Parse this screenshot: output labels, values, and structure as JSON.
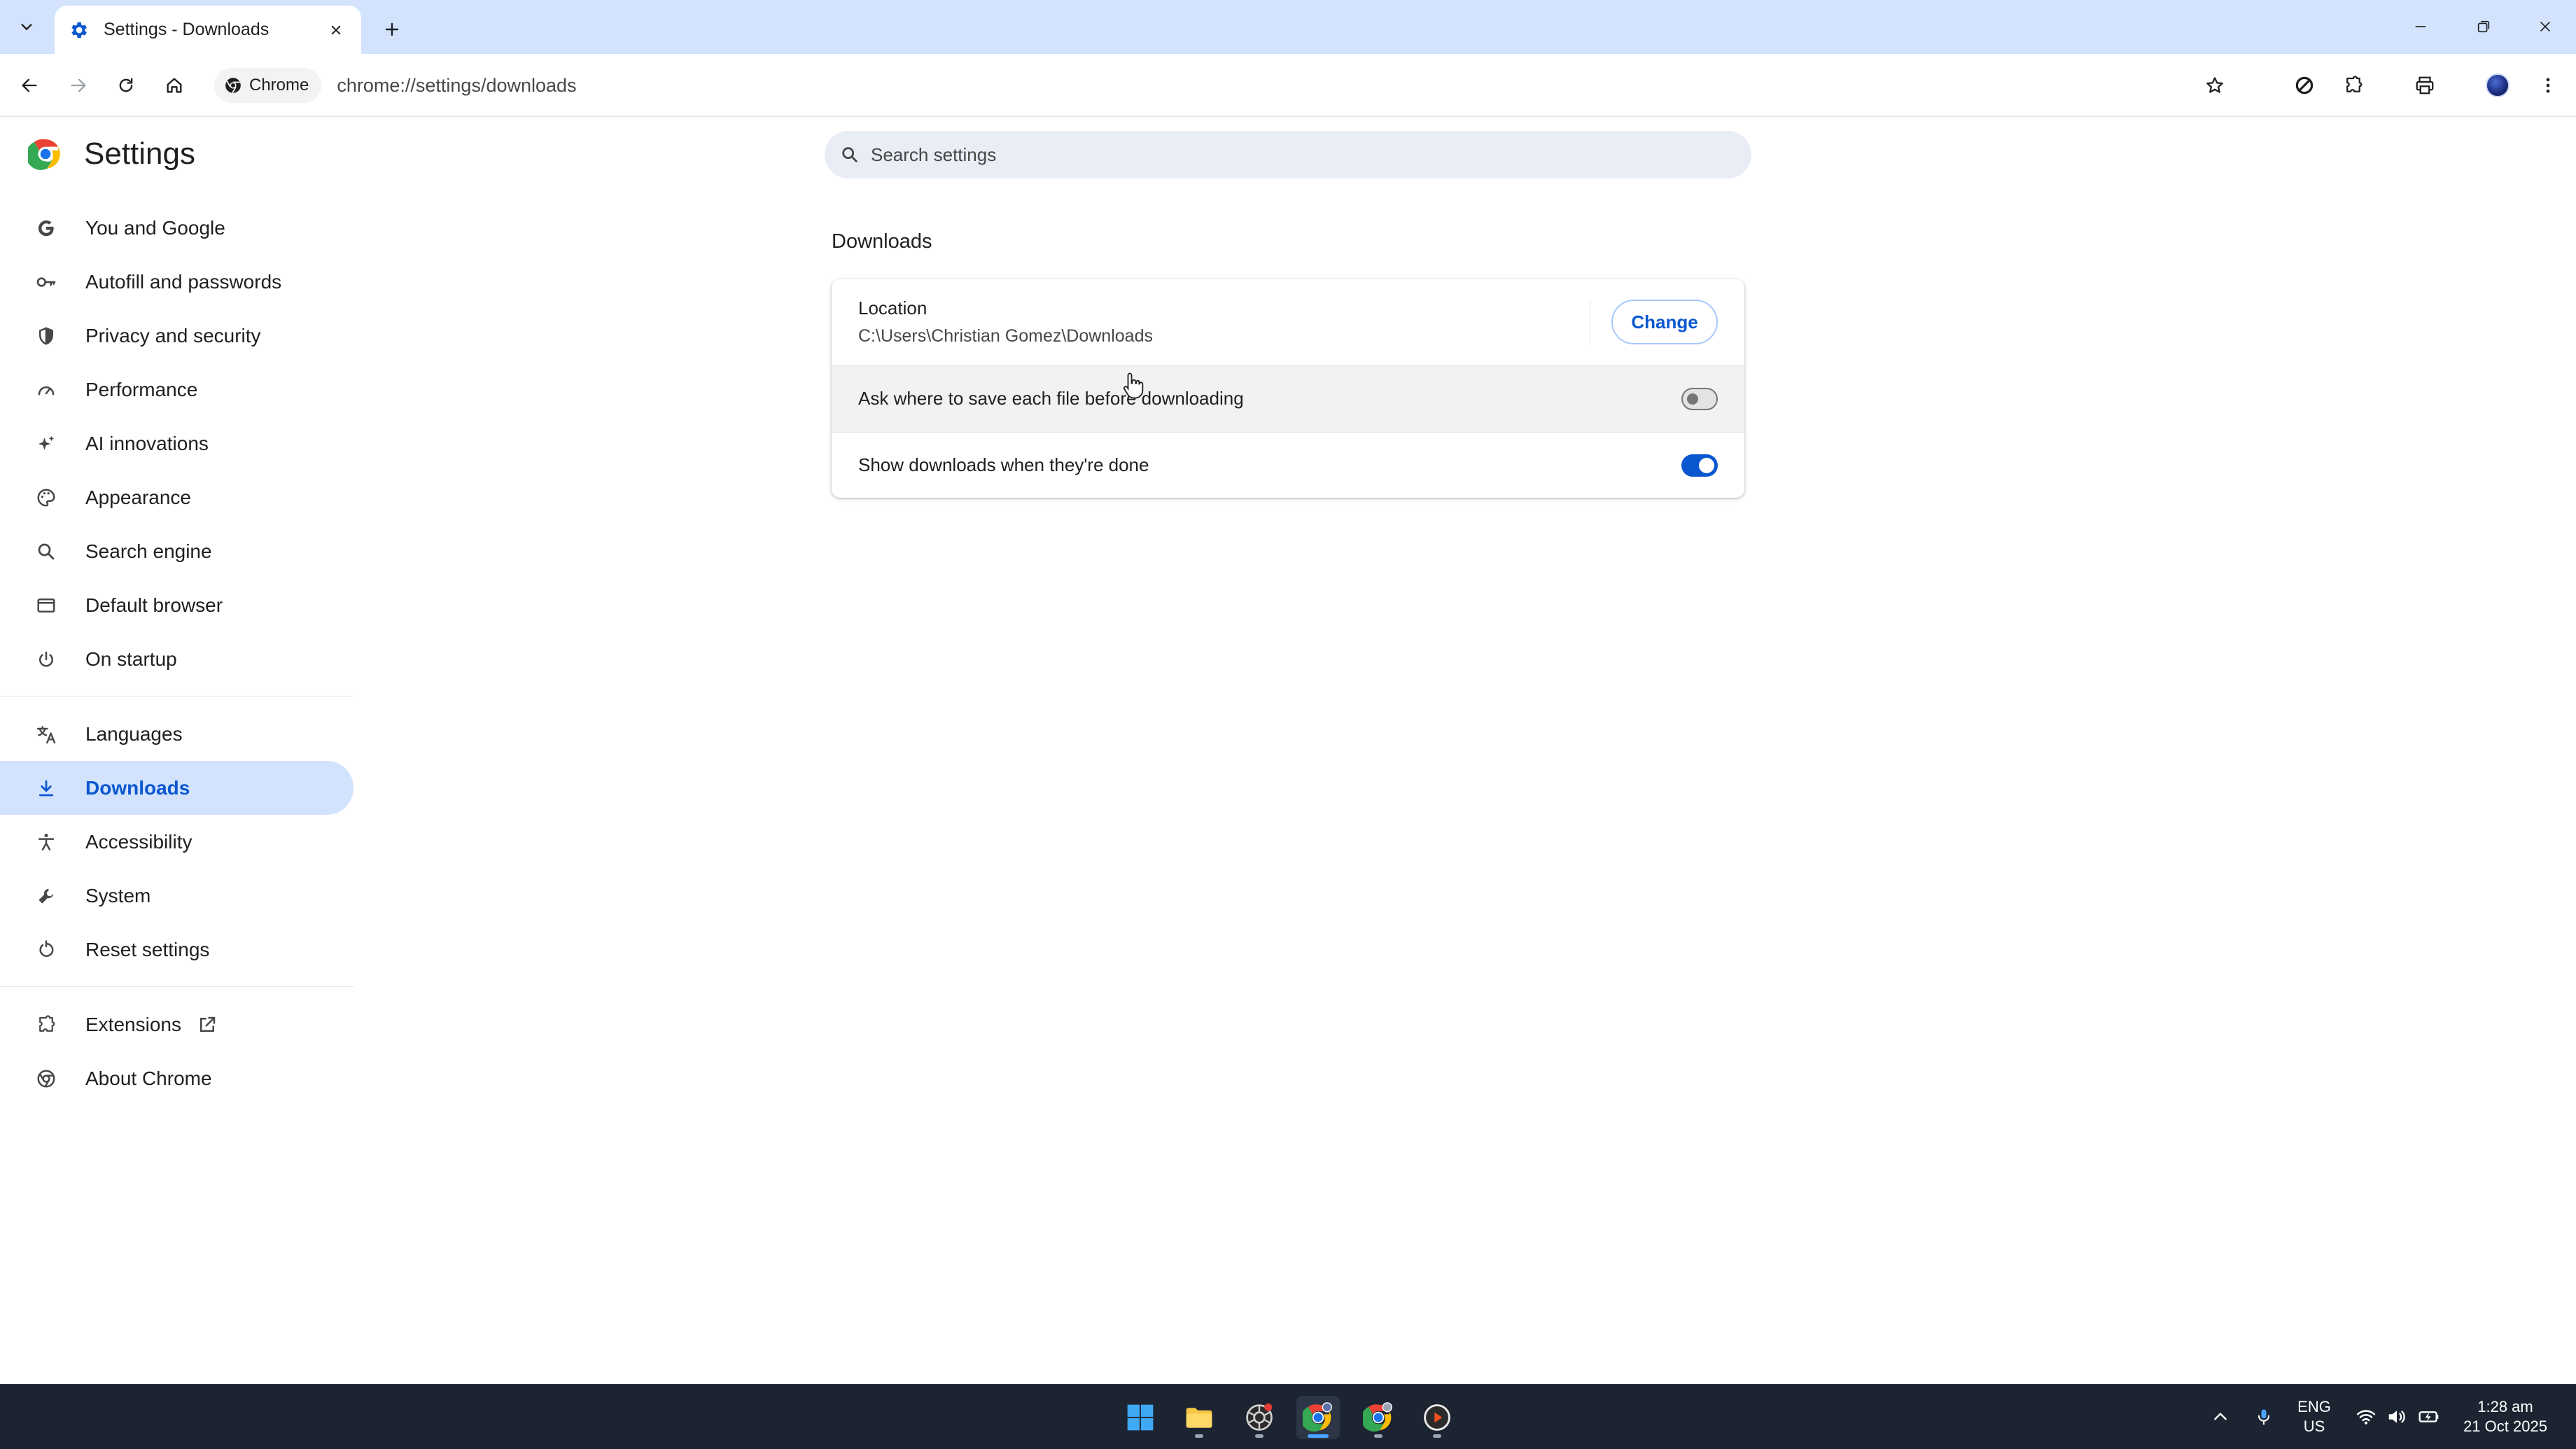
{
  "tabbar": {
    "tab_title": "Settings - Downloads"
  },
  "toolbar": {
    "chip_label": "Chrome",
    "url": "chrome://settings/downloads"
  },
  "settings": {
    "title": "Settings",
    "search_placeholder": "Search settings",
    "nav": [
      {
        "label": "You and Google",
        "icon": "google-g-icon"
      },
      {
        "label": "Autofill and passwords",
        "icon": "key-icon"
      },
      {
        "label": "Privacy and security",
        "icon": "shield-icon"
      },
      {
        "label": "Performance",
        "icon": "speedometer-icon"
      },
      {
        "label": "AI innovations",
        "icon": "sparkle-icon"
      },
      {
        "label": "Appearance",
        "icon": "palette-icon"
      },
      {
        "label": "Search engine",
        "icon": "search-icon"
      },
      {
        "label": "Default browser",
        "icon": "browser-window-icon"
      },
      {
        "label": "On startup",
        "icon": "power-icon"
      },
      {
        "label": "Languages",
        "icon": "translate-icon"
      },
      {
        "label": "Downloads",
        "icon": "download-icon",
        "active": true
      },
      {
        "label": "Accessibility",
        "icon": "accessibility-icon"
      },
      {
        "label": "System",
        "icon": "wrench-icon"
      },
      {
        "label": "Reset settings",
        "icon": "reset-icon"
      },
      {
        "label": "Extensions",
        "icon": "puzzle-icon"
      },
      {
        "label": "About Chrome",
        "icon": "chrome-icon"
      }
    ]
  },
  "downloads": {
    "section_title": "Downloads",
    "location_label": "Location",
    "location_path": "C:\\Users\\Christian Gomez\\Downloads",
    "change_label": "Change",
    "ask_label": "Ask where to save each file before downloading",
    "ask_enabled": false,
    "show_label": "Show downloads when they're done",
    "show_enabled": true
  },
  "taskbar": {
    "lang_top": "ENG",
    "lang_bottom": "US",
    "time": "1:28 am",
    "date": "21 Oct 2025"
  },
  "colors": {
    "accent": "#0b57d0",
    "active_nav_bg": "#d3e3fd",
    "tabbar_bg": "#d3e3fd",
    "taskbar_bg": "#1c2431"
  }
}
